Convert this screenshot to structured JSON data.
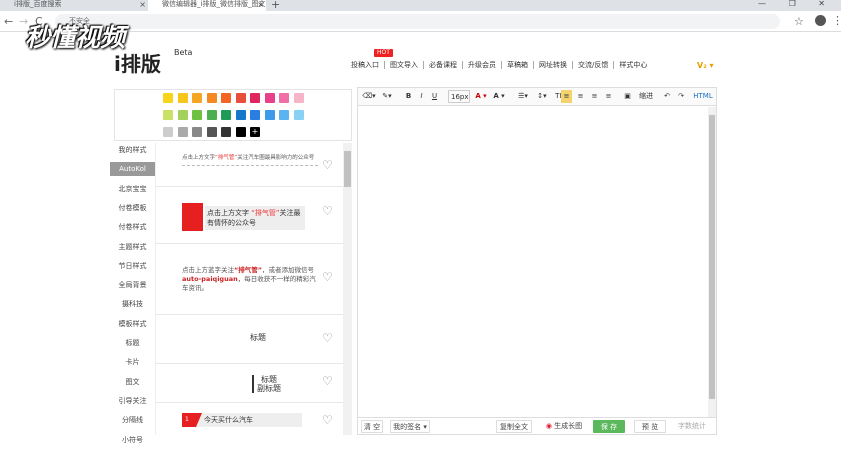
{
  "browser": {
    "tabs": [
      {
        "title": "i排版_百度搜索",
        "close": "×"
      },
      {
        "title": "微信编辑器_i排版_微信排版_图文",
        "close": "×"
      }
    ],
    "new_tab": "+",
    "window_controls": "— ❐ ✕",
    "nav": {
      "back": "←",
      "forward": "→",
      "reload": "C"
    },
    "security_label": "不安全",
    "star": "☆",
    "menu": "⋮"
  },
  "watermark": "秒懂视频",
  "site": {
    "logo": "i排版",
    "beta": "Beta",
    "hot_badge": "HOT",
    "nav": [
      "投稿入口",
      "图文导入",
      "必备课程",
      "升级会员",
      "草稿箱",
      "网址转换",
      "交流/反馈",
      "样式中心"
    ],
    "vip_label": "V₂ ▾"
  },
  "palette": {
    "colors": [
      [
        "#f7d51b",
        "#f7c61b",
        "#f5a623",
        "#f58a23",
        "#f26522",
        "#e94e3d",
        "#e0245e",
        "#e9408c",
        "#f06fa6",
        "#f7b5c8"
      ],
      [
        "#c9e265",
        "#a2d15d",
        "#6fc142",
        "#4caf50",
        "#1e9b57",
        "#1479c8",
        "#2a7de1",
        "#3d9be9",
        "#5bb4ef",
        "#8ad2f5"
      ],
      [
        "#cccccc",
        "#aaaaaa",
        "#888888",
        "#555555",
        "#333333",
        "#000000"
      ]
    ],
    "more_icon": "+"
  },
  "sidebar": {
    "items": [
      {
        "label": "我的样式",
        "active": false
      },
      {
        "label": "AutoKol",
        "active": true
      },
      {
        "label": "北京宝宝",
        "active": false
      },
      {
        "label": "付卷模板",
        "active": false
      },
      {
        "label": "付卷样式",
        "active": false
      },
      {
        "label": "主题样式",
        "active": false
      },
      {
        "label": "节日样式",
        "active": false
      },
      {
        "label": "全局背景",
        "active": false
      },
      {
        "label": "摄科技",
        "active": false
      },
      {
        "label": "模板样式",
        "active": false
      },
      {
        "label": "标题",
        "active": false
      },
      {
        "label": "卡片",
        "active": false
      },
      {
        "label": "图文",
        "active": false
      },
      {
        "label": "引导关注",
        "active": false
      },
      {
        "label": "分隔线",
        "active": false
      },
      {
        "label": "小符号",
        "active": false
      }
    ]
  },
  "templates": {
    "card1": {
      "pre": "点击上方文字",
      "highlight": "“排气管”",
      "post": "关注汽车圈最具影响力的公众号"
    },
    "card2": {
      "pre": "点击上方文字",
      "highlight": "“排气管”",
      "post": "关注最有情怀的公众号"
    },
    "card3": {
      "pre": "点击上方蓝字关注",
      "highlight": "“排气管”",
      "mid": "，或者添加微信号",
      "id": "auto-paiqiguan",
      "post": "，每日收获不一样的精彩汽车资讯。"
    },
    "card4": {
      "title": "标题"
    },
    "card5": {
      "title": "标题",
      "subtitle": "副标题"
    },
    "card6": {
      "number": "1",
      "text": "今天买什么汽车"
    },
    "heart": "♡"
  },
  "editor": {
    "toolbar": {
      "eraser": "⌫▾",
      "brush": "✎▾",
      "bold": "B",
      "italic": "I",
      "underline": "U",
      "font_size": "16px",
      "font_color": "A ▾",
      "bg_color": "A ▾",
      "list": "☰▾",
      "line_height": "↕▾",
      "text_dir": "TI▾",
      "align_left": "≡",
      "align_center": "≡",
      "align_right": "≡",
      "justify": "≡",
      "image": "▣",
      "indent": "缩进",
      "undo": "↶",
      "redo": "↷",
      "html": "HTML"
    },
    "bottom": {
      "clear": "清 空",
      "signature": "我的签名 ▾",
      "copy_all": "复制全文",
      "weibo_icon": "weibo-icon",
      "long_image": "生成长图",
      "save": "保 存",
      "preview": "预 览",
      "word_count": "字数统计"
    }
  }
}
